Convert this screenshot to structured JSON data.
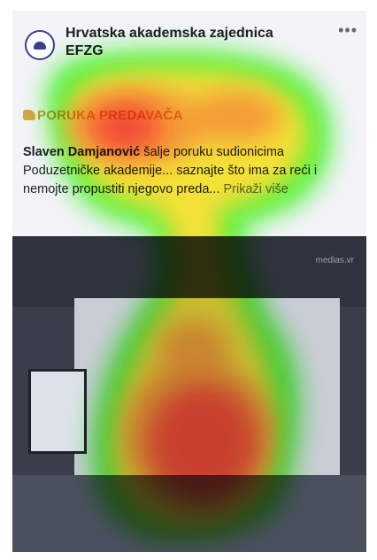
{
  "post": {
    "page_name": "Hrvatska akademska zajednica EFZG",
    "more_label": "•••",
    "headline": "PORUKA PREDAVAČA",
    "author": "Slaven Damjanović",
    "body_text": " šalje poruku sudionicima Poduzetničke akademije... saznajte što ima za reći i nemojte propustiti njegovo preda...",
    "more_link": "Prikaži više"
  },
  "video": {
    "watermark": "medias.vr"
  },
  "colors": {
    "avatar_accent": "#3d3f8c",
    "heat_red": "#ff1a00",
    "heat_yellow": "#ffe600",
    "heat_green": "#19ff00"
  }
}
